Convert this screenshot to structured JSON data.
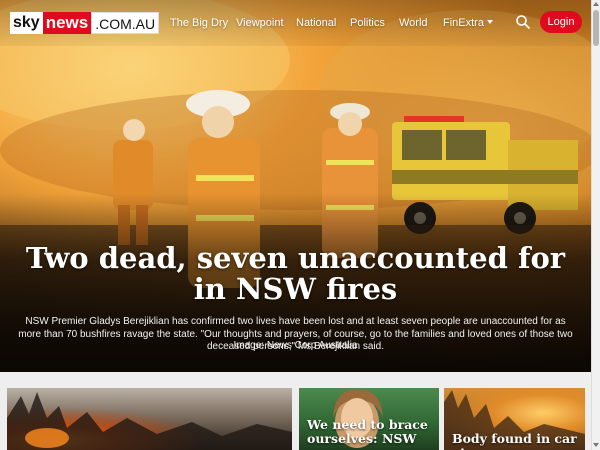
{
  "header": {
    "logo": {
      "sky": "sky",
      "news": "news",
      "domain": ".COM.AU"
    },
    "nav": [
      "The Big Dry",
      "Viewpoint",
      "National",
      "Politics",
      "World",
      "FinExtra"
    ],
    "login_label": "Login",
    "icons": {
      "search": "search-icon",
      "dropdown": "caret-down-icon"
    }
  },
  "hero": {
    "headline": "Two dead, seven unaccounted for in NSW fires",
    "summary": "NSW Premier Gladys Berejiklian has confirmed two lives have been lost and at least seven people are unaccounted for as more than 70 bushfires ravage the state. \"Our thoughts and prayers, of course, go to the families and loved ones of those two deceased persons,\" Ms Berejiklian said.",
    "caption": "Image: News Corp Australia"
  },
  "cards": [
    {
      "title": ""
    },
    {
      "title": "We need to brace ourselves: NSW"
    },
    {
      "title": "Body found in car at"
    }
  ],
  "colors": {
    "brand_red": "#e00a1e",
    "text_white": "#ffffff",
    "page_bg": "#eeeeee"
  }
}
